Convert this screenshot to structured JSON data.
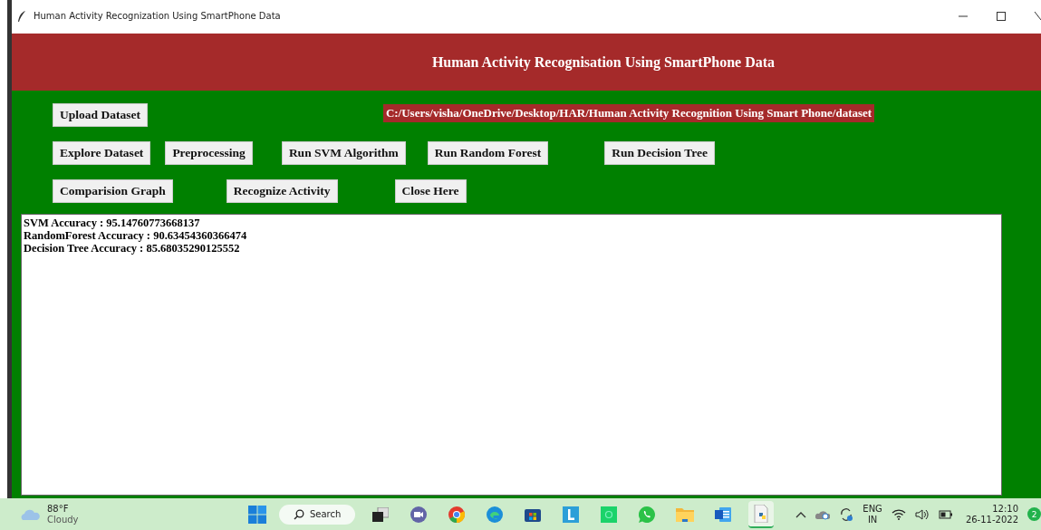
{
  "window": {
    "title": "Human Activity Recognization Using SmartPhone Data"
  },
  "header": {
    "title": "Human Activity Recognisation Using SmartPhone Data"
  },
  "toolbar": {
    "rows": [
      {
        "buttons": [
          "Upload Dataset"
        ],
        "path_label": "C:/Users/visha/OneDrive/Desktop/HAR/Human Activity Recognition Using Smart Phone/dataset"
      },
      {
        "buttons": [
          "Explore Dataset",
          "Preprocessing",
          "Run SVM Algorithm",
          "Run Random Forest",
          "Run Decision Tree"
        ]
      },
      {
        "buttons": [
          "Comparision Graph",
          "Recognize Activity",
          "Close Here"
        ]
      }
    ]
  },
  "output": {
    "lines": [
      "SVM Accuracy : 95.14760773668137",
      "RandomForest Accuracy : 90.63454360366474",
      "Decision Tree Accuracy : 85.68035290125552"
    ]
  },
  "taskbar": {
    "weather": {
      "temperature": "88°F",
      "condition": "Cloudy"
    },
    "search": {
      "placeholder": "Search"
    },
    "apps": [
      {
        "kind": "taskview",
        "selected": false
      },
      {
        "kind": "meet",
        "selected": false
      },
      {
        "kind": "chrome",
        "selected": false
      },
      {
        "kind": "edge",
        "selected": false
      },
      {
        "kind": "store",
        "selected": false
      },
      {
        "kind": "lapp",
        "selected": false
      },
      {
        "kind": "greenapp",
        "selected": false
      },
      {
        "kind": "whatsapp",
        "selected": false
      },
      {
        "kind": "folder",
        "selected": false
      },
      {
        "kind": "word",
        "selected": false
      },
      {
        "kind": "python",
        "selected": true
      }
    ],
    "language": {
      "line1": "ENG",
      "line2": "IN"
    },
    "time": "12:10",
    "date": "26-11-2022",
    "notification_count": "2"
  }
}
